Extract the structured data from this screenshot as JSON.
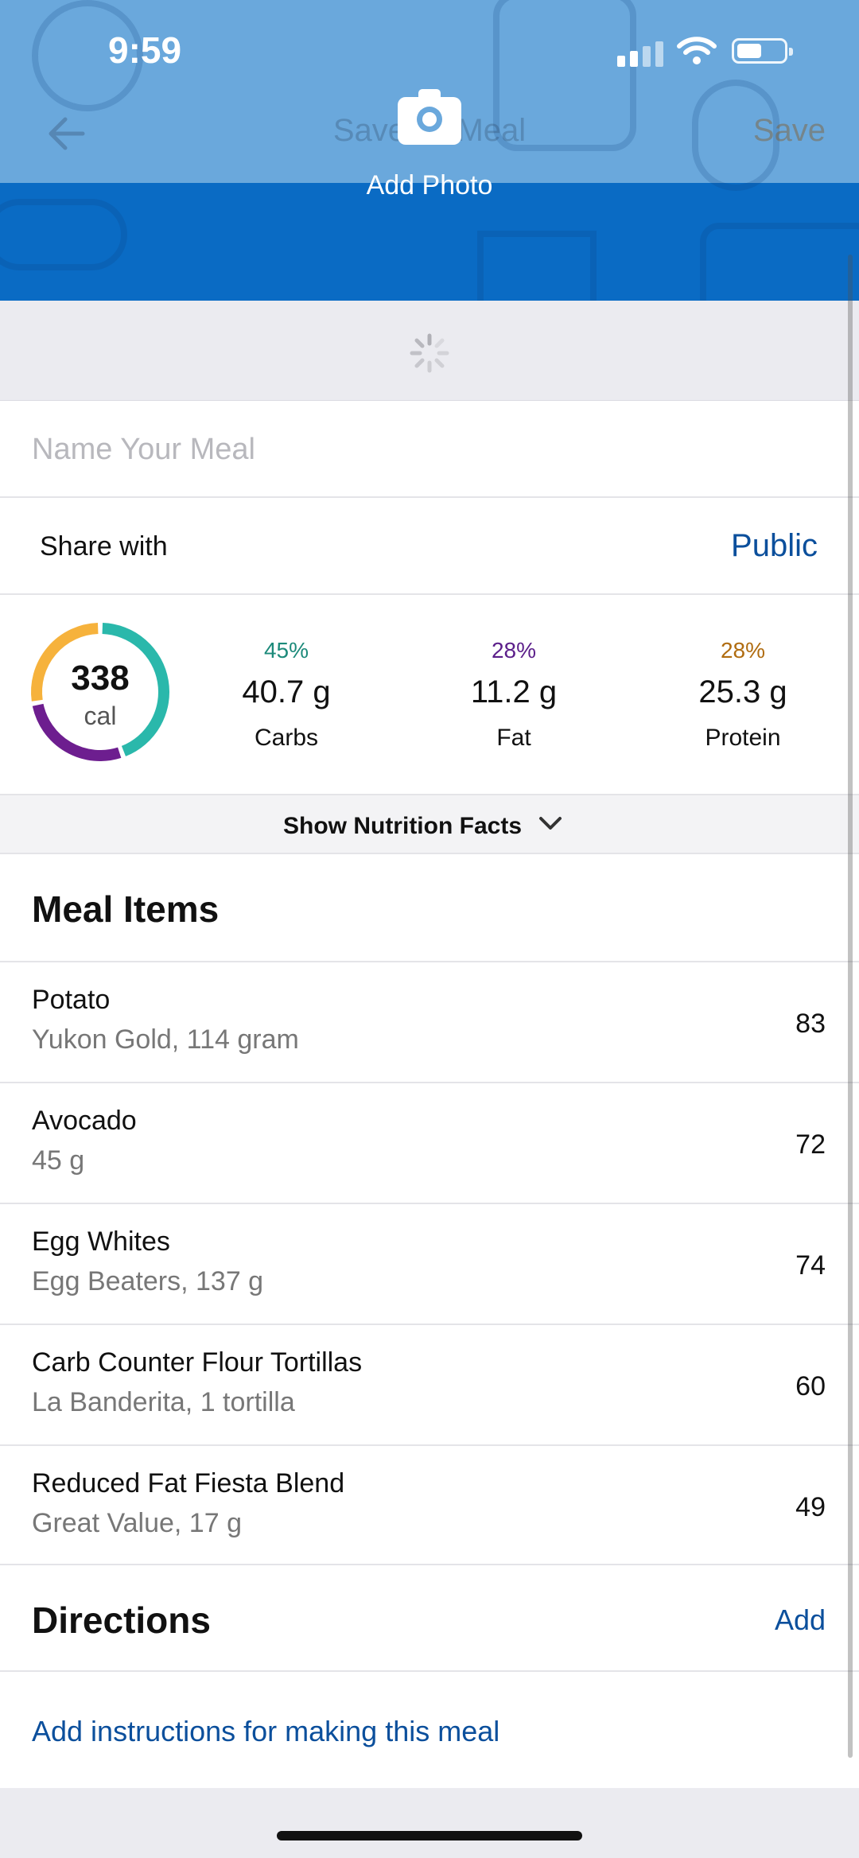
{
  "status_bar": {
    "time": "9:59"
  },
  "nav": {
    "title": "Save as Meal",
    "save_label": "Save",
    "add_photo_label": "Add Photo"
  },
  "meal_name": {
    "placeholder": "Name Your Meal",
    "value": ""
  },
  "share": {
    "label": "Share with",
    "value": "Public"
  },
  "summary": {
    "calories": "338",
    "calories_unit": "cal",
    "macros": [
      {
        "pct": "45%",
        "grams": "40.7 g",
        "label": "Carbs",
        "color": "#1c8a7a"
      },
      {
        "pct": "28%",
        "grams": "11.2 g",
        "label": "Fat",
        "color": "#5b1e8a"
      },
      {
        "pct": "28%",
        "grams": "25.3 g",
        "label": "Protein",
        "color": "#b06c10"
      }
    ],
    "ring_colors": {
      "carbs": "#2ab8ab",
      "fat": "#6d1e8f",
      "protein": "#f6b23c"
    }
  },
  "nutrition_toggle": {
    "label": "Show Nutrition Facts"
  },
  "meal_items": {
    "title": "Meal Items",
    "items": [
      {
        "name": "Potato",
        "detail": "Yukon Gold, 114 gram",
        "calories": "83"
      },
      {
        "name": "Avocado",
        "detail": "45 g",
        "calories": "72"
      },
      {
        "name": "Egg Whites",
        "detail": "Egg Beaters, 137 g",
        "calories": "74"
      },
      {
        "name": "Carb Counter Flour Tortillas",
        "detail": "La Banderita, 1 tortilla",
        "calories": "60"
      },
      {
        "name": "Reduced Fat Fiesta Blend",
        "detail": "Great Value, 17 g",
        "calories": "49"
      }
    ]
  },
  "directions": {
    "title": "Directions",
    "add_label": "Add",
    "instructions_link": "Add instructions for making this meal"
  },
  "colors": {
    "accent": "#0b4f9c",
    "header_blue": "#0a6bc4"
  }
}
